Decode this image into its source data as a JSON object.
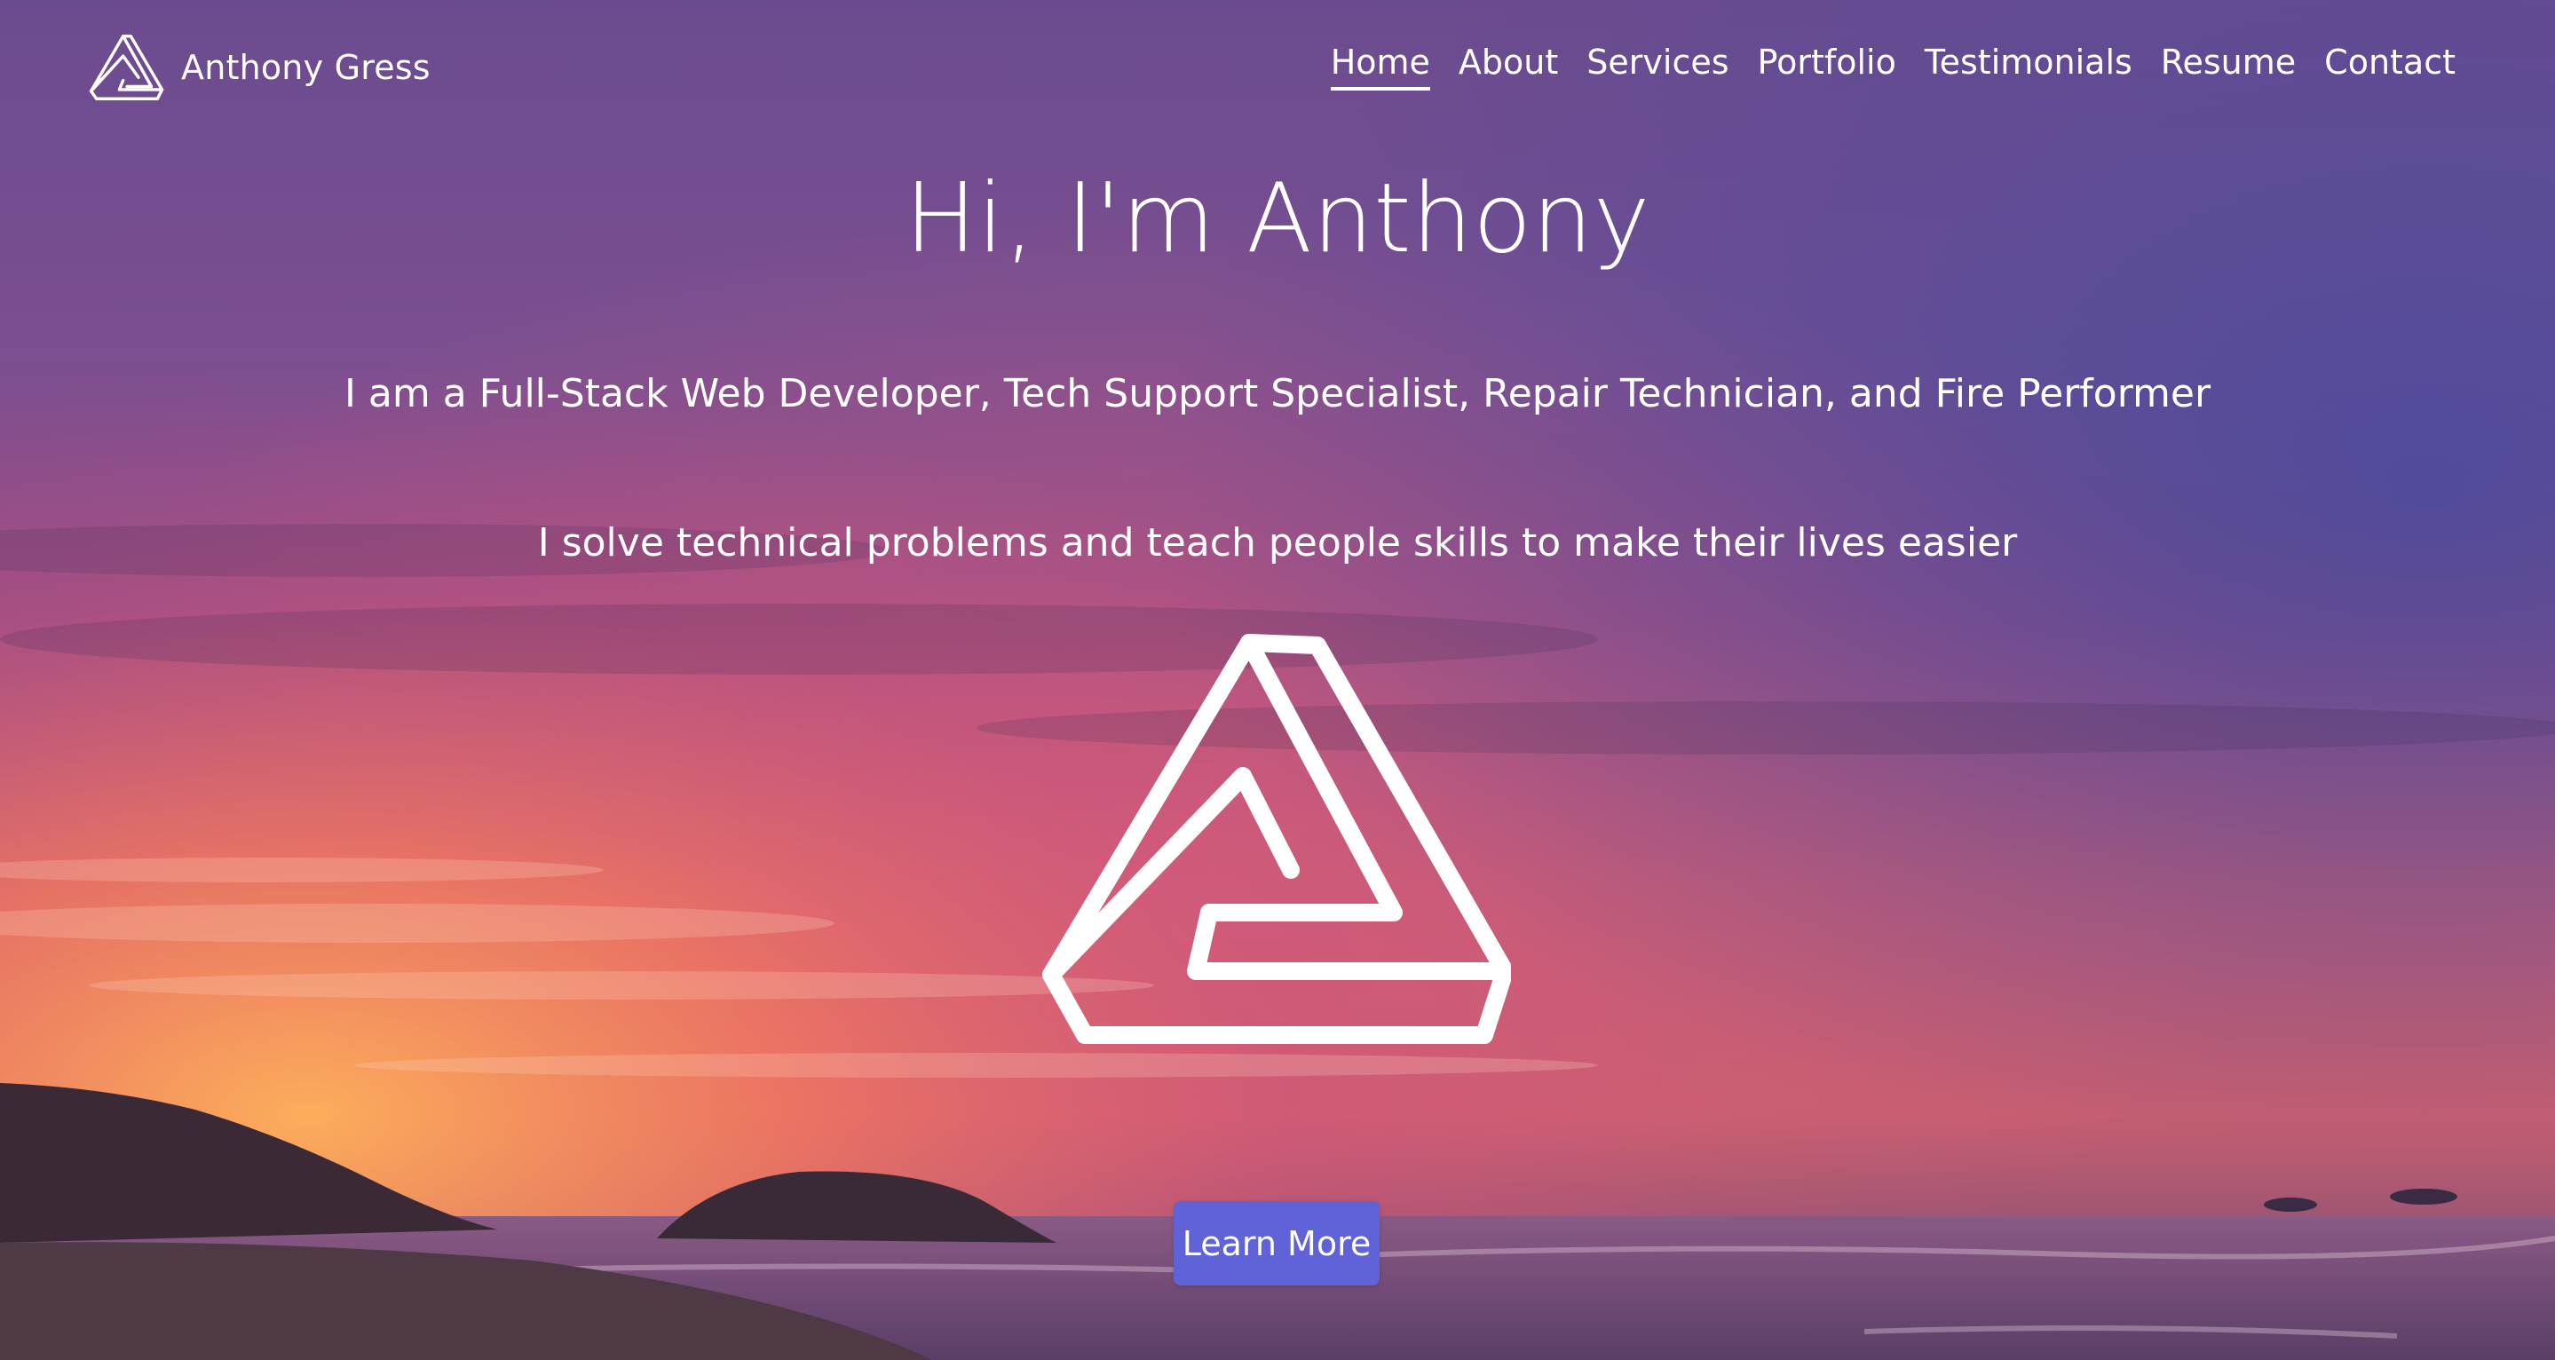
{
  "header": {
    "brand_name": "Anthony Gress",
    "logo_icon": "penrose-triangle-icon"
  },
  "nav": {
    "items": [
      {
        "label": "Home",
        "active": true
      },
      {
        "label": "About",
        "active": false
      },
      {
        "label": "Services",
        "active": false
      },
      {
        "label": "Portfolio",
        "active": false
      },
      {
        "label": "Testimonials",
        "active": false
      },
      {
        "label": "Resume",
        "active": false
      },
      {
        "label": "Contact",
        "active": false
      }
    ]
  },
  "hero": {
    "title": "Hi, I'm Anthony",
    "subtitle_1": "I am a Full-Stack Web Developer, Tech Support Specialist, Repair Technician, and Fire Performer",
    "subtitle_2": "I solve technical problems and teach people skills to make their lives easier",
    "center_icon": "penrose-triangle-icon",
    "button_label": "Learn More",
    "background": "sunset-beach-photo"
  },
  "colors": {
    "button_bg": "#6062d8",
    "text": "#ffffff",
    "sky_top": "#6a4a8c",
    "sky_orange": "#f07a5a"
  }
}
